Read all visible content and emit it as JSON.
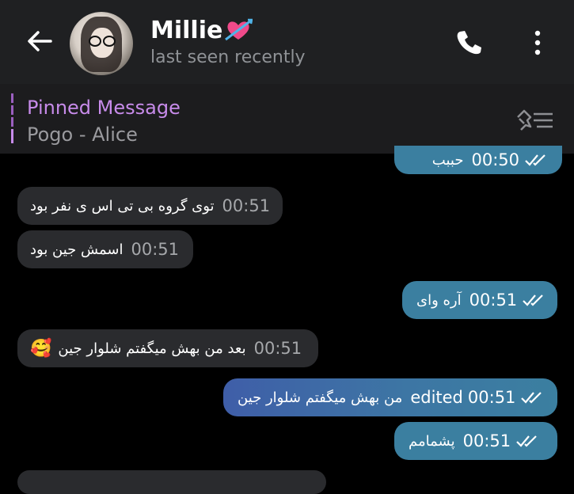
{
  "header": {
    "contact_name": "Millie",
    "status": "last seen recently",
    "icons": [
      "back-arrow-icon",
      "heart-with-arrow-emoji",
      "phone-icon",
      "more-vertical-icon"
    ]
  },
  "pinned": {
    "title": "Pinned Message",
    "preview": "Pogo - Alice",
    "icon": "unpin-list-icon"
  },
  "messages": [
    {
      "direction": "outgoing",
      "text": "حببب",
      "time": "00:50",
      "read": true
    },
    {
      "direction": "incoming",
      "text": "توی گروه بی تی اس ی نفر بود",
      "time": "00:51"
    },
    {
      "direction": "incoming",
      "text": "اسمش جین بود",
      "time": "00:51"
    },
    {
      "direction": "outgoing",
      "text": "آره وای",
      "time": "00:51",
      "read": true
    },
    {
      "direction": "incoming",
      "text": "بعد من بهش میگفتم شلوار جین",
      "emoji": "🥰",
      "time": "00:51"
    },
    {
      "direction": "outgoing",
      "text": "من بهش میگفتم شلوار جین",
      "edited_label": "edited",
      "time": "00:51",
      "read": true
    },
    {
      "direction": "outgoing",
      "text": "پشمامم",
      "time": "00:51",
      "read": true
    }
  ],
  "colors": {
    "header_bg": "#1f2022",
    "outgoing_bubble": "#3b7fa0",
    "incoming_bubble": "#2a2b2e",
    "pinned_accent": "#c78bea"
  }
}
